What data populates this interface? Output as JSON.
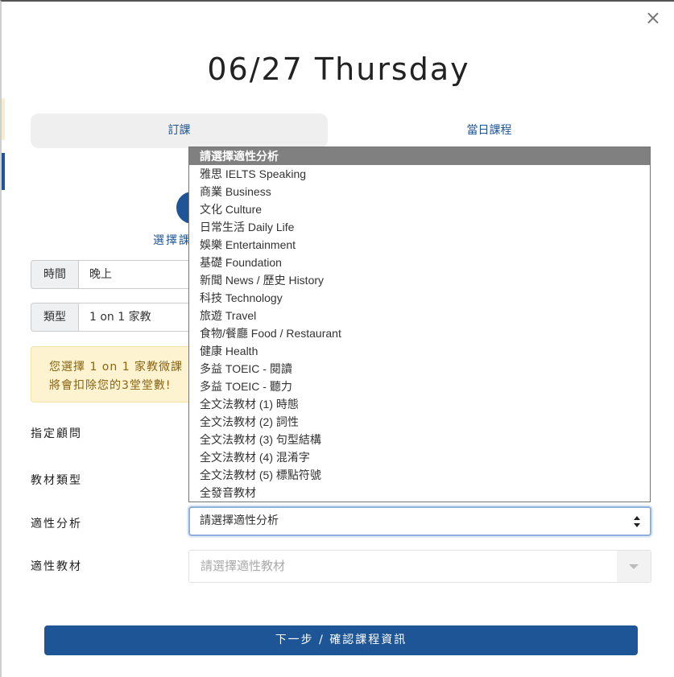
{
  "modal": {
    "title": "06/27 Thursday",
    "close_glyph": "×"
  },
  "tabs": [
    {
      "label": "訂課",
      "active": true
    },
    {
      "label": "當日課程",
      "active": false
    }
  ],
  "step": {
    "label": "選擇課"
  },
  "time": {
    "addon": "時間",
    "value": "晚上"
  },
  "type": {
    "addon": "類型",
    "value": "1 on 1 家教"
  },
  "alert": {
    "line1": "您選擇 1 on 1 家教微課",
    "line2": "將會扣除您的3堂堂數!"
  },
  "labels": {
    "consultant": "指定顧問",
    "material_type": "教材類型",
    "aptitude": "適性分析",
    "aptitude_material": "適性教材"
  },
  "aptitude_select": {
    "value": "請選擇適性分析",
    "options": [
      "請選擇適性分析",
      "雅思 IELTS Speaking",
      "商業 Business",
      "文化 Culture",
      "日常生活 Daily Life",
      "娛樂 Entertainment",
      "基礎 Foundation",
      "新聞 News / 歷史 History",
      "科技 Technology",
      "旅遊 Travel",
      "食物/餐廳 Food / Restaurant",
      "健康 Health",
      "多益 TOEIC - 閱讀",
      "多益 TOEIC - 聽力",
      "全文法教材 (1) 時態",
      "全文法教材 (2) 詞性",
      "全文法教材 (3) 句型結構",
      "全文法教材 (4) 混淆字",
      "全文法教材 (5) 標點符號",
      "全發音教材"
    ],
    "selected_index": 0
  },
  "aptitude_material_select": {
    "placeholder": "請選擇適性教材"
  },
  "next_button": {
    "label": "下一步 / 確認課程資訊"
  },
  "colors": {
    "primary": "#1d5597",
    "alert_bg": "#fdf3d0",
    "alert_text": "#8a6411",
    "selected_option_bg": "#808080"
  }
}
